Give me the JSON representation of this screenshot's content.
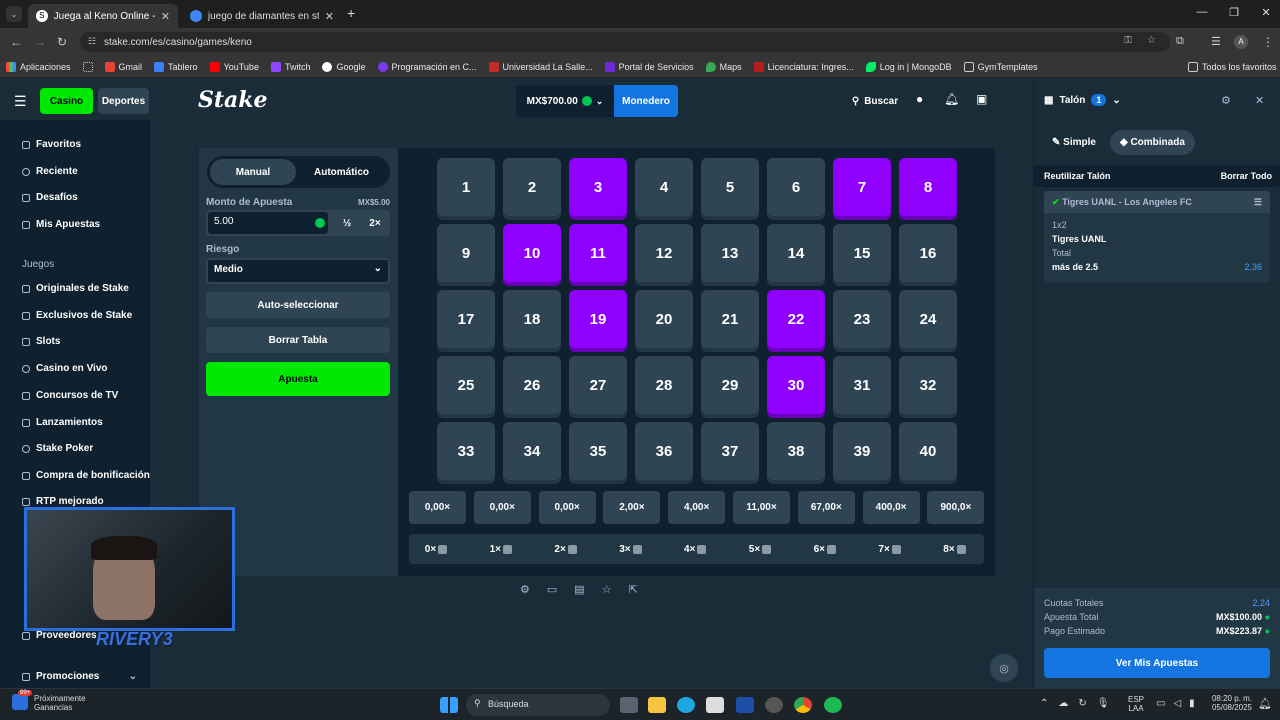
{
  "browser": {
    "tabs": [
      {
        "title": "Juega al Keno Online - Jueg"
      },
      {
        "title": "juego de diamantes en stake - "
      }
    ],
    "url": "stake.com/es/casino/games/keno",
    "bookmarks": [
      "Aplicaciones",
      "Gmail",
      "Tablero",
      "YouTube",
      "Twitch",
      "Google",
      "Programación en C...",
      "Universidad La Salle...",
      "Portal de Servicios",
      "Maps",
      "Licenciatura: Ingres...",
      "Log in | MongoDB",
      "GymTemplates"
    ],
    "all_favorites": "Todos los favoritos",
    "profile": "A"
  },
  "header": {
    "casino": "Casino",
    "sports": "Deportes",
    "logo": "Stake",
    "balance": "MX$700.00",
    "wallet": "Monedero",
    "search": "Buscar"
  },
  "sidebar": {
    "items": [
      "Favoritos",
      "Reciente",
      "Desafíos",
      "Mis Apuestas"
    ],
    "section": "Juegos",
    "games": [
      "Originales de Stake",
      "Exclusivos de Stake",
      "Slots",
      "Casino en Vivo",
      "Concursos de TV",
      "Lanzamientos",
      "Stake Poker",
      "Compra de bonificación",
      "RTP mejorado"
    ],
    "providers": "Proveedores",
    "promos": "Promociones"
  },
  "controls": {
    "tabs": [
      "Manual",
      "Automático"
    ],
    "bet_label": "Monto de Apuesta",
    "bet_hint": "MX$5.00",
    "bet_value": "5.00",
    "half": "½",
    "double": "2×",
    "risk_label": "Riesgo",
    "risk_value": "Medio",
    "auto_pick": "Auto-seleccionar",
    "clear": "Borrar Tabla",
    "bet_button": "Apuesta"
  },
  "board": {
    "numbers": [
      "1",
      "2",
      "3",
      "4",
      "5",
      "6",
      "7",
      "8",
      "9",
      "10",
      "11",
      "12",
      "13",
      "14",
      "15",
      "16",
      "17",
      "18",
      "19",
      "20",
      "21",
      "22",
      "23",
      "24",
      "25",
      "26",
      "27",
      "28",
      "29",
      "30",
      "31",
      "32",
      "33",
      "34",
      "35",
      "36",
      "37",
      "38",
      "39",
      "40"
    ],
    "selected": [
      3,
      7,
      8,
      10,
      11,
      19,
      22,
      30
    ],
    "payouts": [
      "0,00×",
      "0,00×",
      "0,00×",
      "2,00×",
      "4,00×",
      "11,00×",
      "67,00×",
      "400,0×",
      "900,0×"
    ],
    "hits": [
      "0×",
      "1×",
      "2×",
      "3×",
      "4×",
      "5×",
      "6×",
      "7×",
      "8×"
    ]
  },
  "betslip": {
    "title": "Talón",
    "count": "1",
    "tabs": [
      "Simple",
      "Combinada"
    ],
    "reuse": "Reutilizar Talón",
    "clear_all": "Borrar Todo",
    "match": "Tigres UANL - Los Angeles FC",
    "market": "1x2",
    "selection": "Tigres UANL",
    "market2": "Total",
    "selection2": "más de 2.5",
    "odds": "2,36",
    "total_odds_label": "Cuotas Totales",
    "total_odds": "2,24",
    "stake_label": "Apuesta Total",
    "stake": "MX$100.00",
    "payout_label": "Pago Estimado",
    "payout": "MX$223.87",
    "view_bets": "Ver Mis Apuestas"
  },
  "webcam": {
    "name": "RIVERY3"
  },
  "taskbar": {
    "notice_title": "Próximamente",
    "notice_sub": "Ganancias",
    "badge": "99+",
    "search": "Búsqueda",
    "lang": "ESP",
    "lang2": "LAA",
    "time": "08:20 p. m.",
    "date": "05/08/2025"
  },
  "colors": {
    "accent_green": "#00e701",
    "selected_purple": "#9000ff",
    "tile": "#2f4553",
    "wallet_blue": "#1475e1"
  }
}
